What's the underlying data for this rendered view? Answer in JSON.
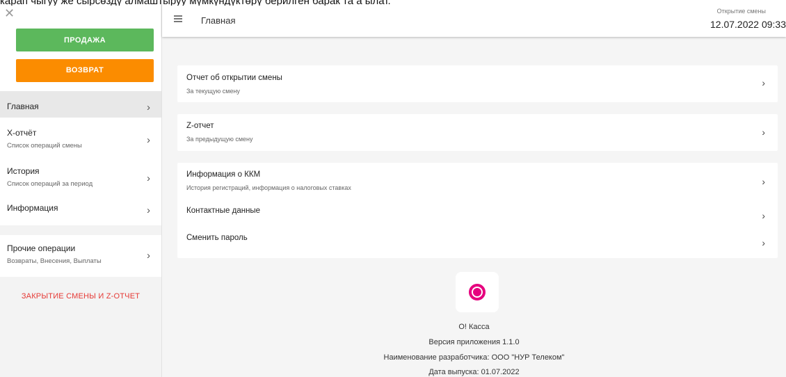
{
  "caption": "карап чыгуу же сырсөздү алмаштыруу мүмкүндүктөрү берилген барак та а ылат.",
  "sidebar": {
    "close": "✕",
    "sale_button": "ПРОДАЖА",
    "return_button": "ВОЗВРАТ",
    "items": [
      {
        "label": "Главная",
        "sub": ""
      },
      {
        "label": "Х-отчёт",
        "sub": "Список операций смены"
      },
      {
        "label": "История",
        "sub": "Список операций за период"
      },
      {
        "label": "Информация",
        "sub": ""
      },
      {
        "label": "Прочие операции",
        "sub": "Возвраты, Внесения, Выплаты"
      }
    ],
    "close_shift": "ЗАКРЫТИЕ СМЕНЫ И Z-ОТЧЕТ"
  },
  "header": {
    "title": "Главная",
    "shift_label": "Открытие смены",
    "shift_datetime": "12.07.2022 09:33"
  },
  "cards": [
    {
      "title": "Отчет об открытии смены",
      "sub": "За текущую смену"
    },
    {
      "title": "Z-отчет",
      "sub": "За предыдущую смену"
    },
    {
      "title": "Информация о ККМ",
      "sub": "История регистраций, информация о налоговых ставках"
    },
    {
      "title": "Контактные данные",
      "sub": ""
    },
    {
      "title": "Сменить пароль",
      "sub": ""
    }
  ],
  "app_info": {
    "name": "О! Касса",
    "version": "Версия приложения 1.1.0",
    "developer": "Наименование разработчика: ООО \"НУР Телеком\"",
    "release": "Дата выпуска: 01.07.2022"
  },
  "colors": {
    "sale": "#5cb85c",
    "return": "#fb8c00",
    "close_shift": "#e53935",
    "logo": "#e6007e"
  },
  "icons": {
    "chevron": "›",
    "menu": "hamburger-icon",
    "logo": "o-kassa-logo-icon"
  }
}
